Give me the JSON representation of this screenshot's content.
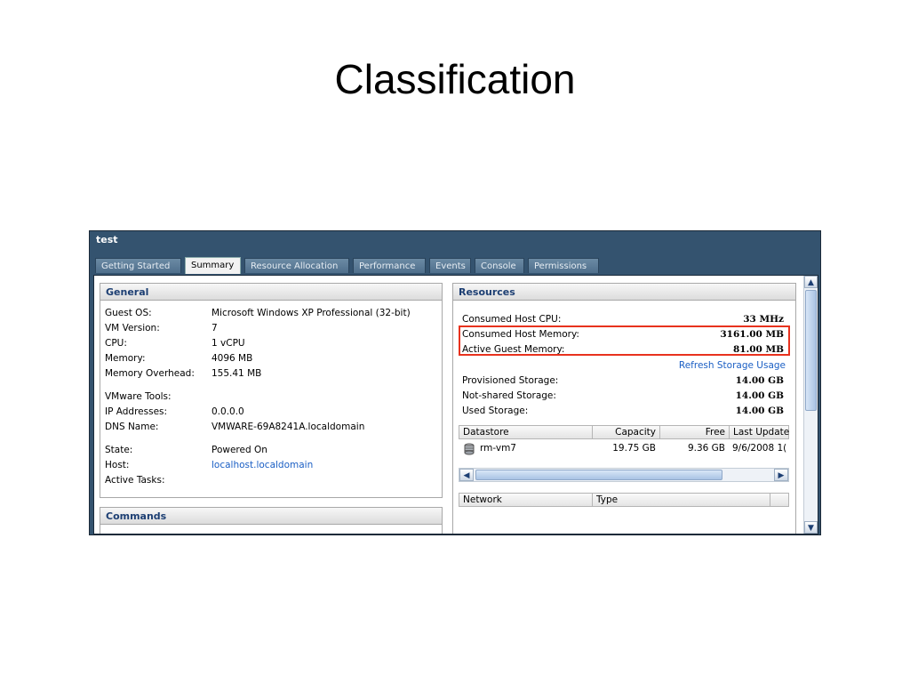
{
  "slide": {
    "title": "Classification"
  },
  "window": {
    "title": "test",
    "tabs": [
      "Getting Started",
      "Summary",
      "Resource Allocation",
      "Performance",
      "Events",
      "Console",
      "Permissions"
    ],
    "active_tab": "Summary"
  },
  "general": {
    "header": "General",
    "rows": [
      {
        "label": "Guest OS:",
        "value": "Microsoft Windows XP Professional (32-bit)"
      },
      {
        "label": "VM Version:",
        "value": "7"
      },
      {
        "label": "CPU:",
        "value": "1 vCPU"
      },
      {
        "label": "Memory:",
        "value": "4096 MB"
      },
      {
        "label": "Memory Overhead:",
        "value": "155.41 MB"
      },
      {
        "label": "VMware Tools:",
        "value": ""
      },
      {
        "label": "IP Addresses:",
        "value": "0.0.0.0"
      },
      {
        "label": "DNS Name:",
        "value": "VMWARE-69A8241A.localdomain"
      },
      {
        "label": "State:",
        "value": "Powered On"
      },
      {
        "label": "Host:",
        "value": "localhost.localdomain"
      },
      {
        "label": "Active Tasks:",
        "value": ""
      }
    ]
  },
  "commands": {
    "header": "Commands"
  },
  "resources": {
    "header": "Resources",
    "rows": [
      {
        "label": "Consumed Host CPU:",
        "value": "33 MHz"
      },
      {
        "label": "Consumed Host Memory:",
        "value": "3161.00 MB"
      },
      {
        "label": "Active Guest Memory:",
        "value": "81.00 MB"
      }
    ],
    "refresh_link": "Refresh Storage Usage",
    "storage": [
      {
        "label": "Provisioned Storage:",
        "value": "14.00 GB"
      },
      {
        "label": "Not-shared Storage:",
        "value": "14.00 GB"
      },
      {
        "label": "Used Storage:",
        "value": "14.00 GB"
      }
    ],
    "datastore_table": {
      "columns": [
        "Datastore",
        "Capacity",
        "Free",
        "Last Update"
      ],
      "rows": [
        {
          "name": "rm-vm7",
          "capacity": "19.75 GB",
          "free": "9.36 GB",
          "last_update": "9/6/2008 1("
        }
      ]
    },
    "network_table": {
      "columns": [
        "Network",
        "Type"
      ]
    }
  },
  "colors": {
    "highlight_box": "#e8321e",
    "header_text": "#1d3f73",
    "window_frame": "#34536f",
    "link": "#1b5fc4"
  },
  "icons": [
    "datastore-icon",
    "scroll-left-icon",
    "scroll-right-icon",
    "scroll-up-icon",
    "scroll-down-icon"
  ]
}
